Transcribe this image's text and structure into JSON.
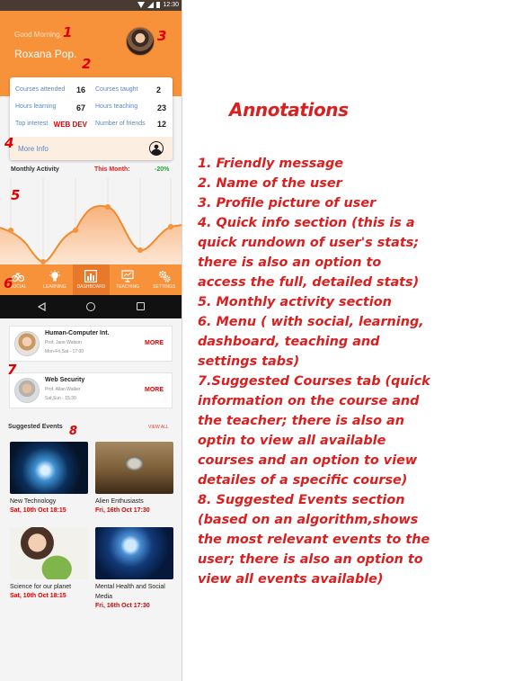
{
  "status_bar": {
    "time": "12:30"
  },
  "header": {
    "greeting": "Good Morning,",
    "user_name": "Roxana Pop.",
    "avatar_icon": "profile-photo"
  },
  "quick_info": {
    "stats": [
      {
        "label": "Courses attended",
        "value": "16"
      },
      {
        "label": "Courses taught",
        "value": "2"
      },
      {
        "label": "Hours learning",
        "value": "67"
      },
      {
        "label": "Hours teaching",
        "value": "23"
      },
      {
        "label": "Top interest",
        "value": "WEB DEV"
      },
      {
        "label": "Number of friends",
        "value": "12"
      }
    ],
    "more_info_label": "More Info",
    "user_icon": "user-circle-icon"
  },
  "activity": {
    "title": "Monthly Activity",
    "period_label": "This Month:",
    "change": "-20%"
  },
  "tabs": [
    {
      "label": "SOCIAL",
      "icon": "bicycle-icon"
    },
    {
      "label": "LEARNING",
      "icon": "lightbulb-icon"
    },
    {
      "label": "DASHBOARD",
      "icon": "chart-icon"
    },
    {
      "label": "TEACHING",
      "icon": "presentation-icon"
    },
    {
      "label": "SETTINGS",
      "icon": "gear-icon"
    }
  ],
  "active_tab": "DASHBOARD",
  "courses": [
    {
      "title": "Human-Computer Int.",
      "teacher": "Prof. Jane Watson",
      "time": "Mon-Fri,Sat - 17:00",
      "more_label": "MORE"
    },
    {
      "title": "Web Security",
      "teacher": "Prof. Allan Walker",
      "time": "Sat,Sun - 15:30",
      "more_label": "MORE"
    }
  ],
  "events_section": {
    "title": "Suggested Events",
    "view_all": "VIEW ALL"
  },
  "events": [
    {
      "name": "New Technology",
      "date": "Sat, 10th Oct  18:15"
    },
    {
      "name": "Alien Enthusiasts",
      "date": "Fri, 16th Oct  17:30"
    },
    {
      "name": "Science for our planet",
      "date": "Sat, 10th Oct  18:15"
    },
    {
      "name": "Mental Health and Social Media",
      "date": "Fri, 16th Oct  17:30"
    }
  ],
  "markers": [
    "1",
    "2",
    "3",
    "4",
    "5",
    "6",
    "7",
    "8"
  ],
  "annotations": {
    "title": "Annotations",
    "items": [
      "1. Friendly message",
      "2. Name of the user",
      "3. Profile picture of user",
      "4. Quick info section (this is a quick rundown of user's stats; there is also an option to access the full, detailed stats)",
      "5. Monthly activity section",
      "6. Menu ( with social, learning, dashboard, teaching and settings tabs)",
      "7.Suggested Courses tab (quick information on the course and the teacher; there is also an optin to view all available courses and an option to view detailes of a specific course)",
      "8. Suggested Events section (based on an algorithm,shows the most relevant events to the user; there is also an option to view all events available)"
    ]
  },
  "colors": {
    "accent": "#f7923a",
    "annotation_red": "#d92020",
    "link_blue": "#5b86c4",
    "positive_green": "#22a33a"
  }
}
